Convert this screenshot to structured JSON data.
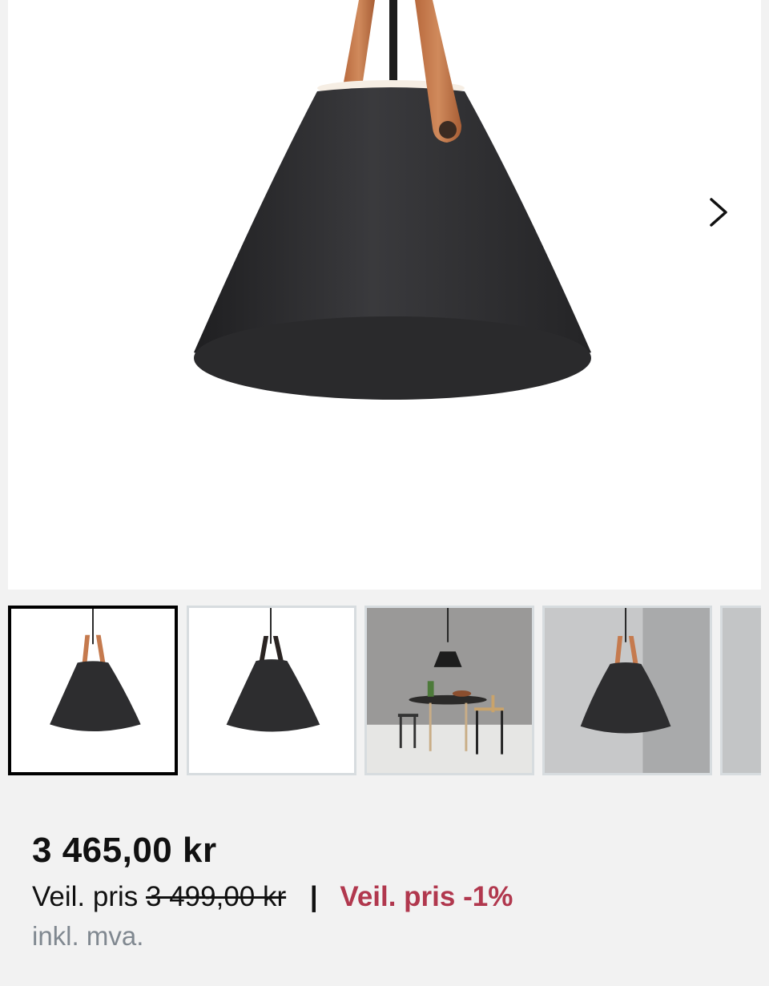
{
  "gallery": {
    "next_label": "next-image",
    "thumbnails": [
      {
        "name": "thumb-lamp-front",
        "active": true
      },
      {
        "name": "thumb-lamp-dark-strap",
        "active": false
      },
      {
        "name": "thumb-lamp-dining-room",
        "active": false
      },
      {
        "name": "thumb-lamp-grey-wall",
        "active": false
      },
      {
        "name": "thumb-partial",
        "active": false
      }
    ]
  },
  "price": {
    "current": "3 465,00 kr",
    "recommended_label": "Veil. pris",
    "recommended_value": "3 499,00 kr",
    "separator": "|",
    "discount": "Veil. pris -1%",
    "vat_note": "inkl. mva."
  },
  "colors": {
    "discount": "#b1384e",
    "strap": "#c57a4e",
    "shade": "#2b2b2d",
    "active_border": "#000000"
  }
}
